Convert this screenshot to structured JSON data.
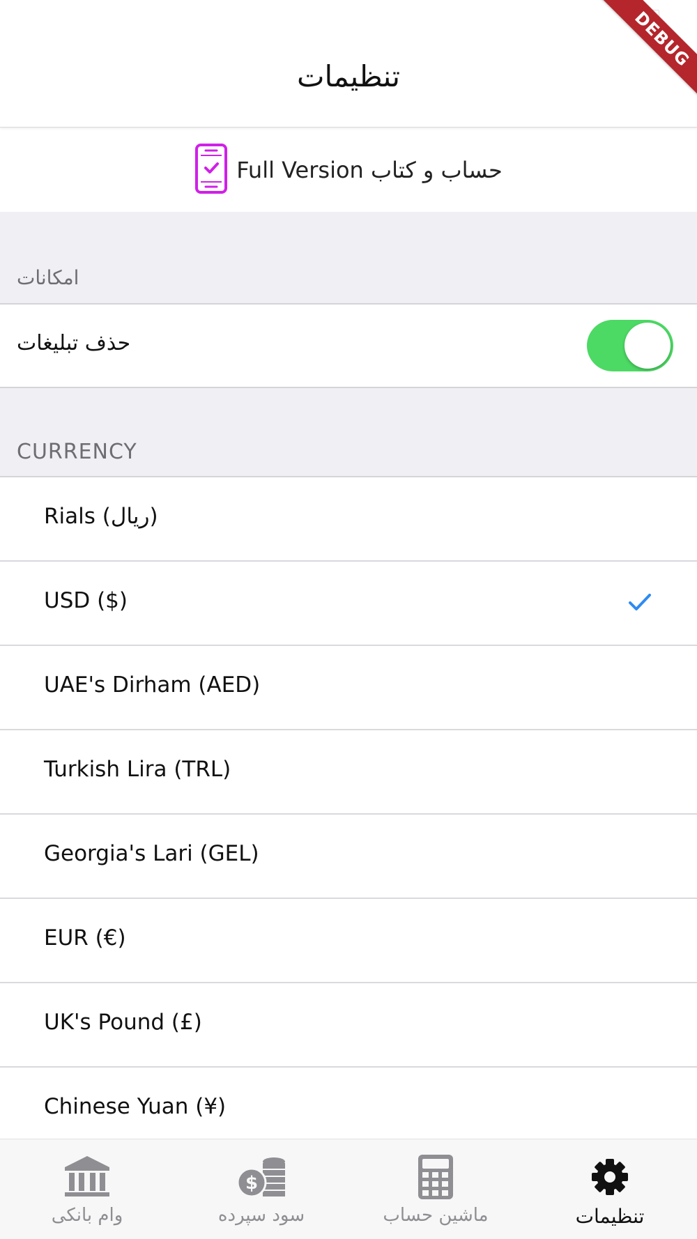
{
  "header": {
    "title": "تنظیمات",
    "debug_banner": "DEBUG"
  },
  "full_version": {
    "label": "حساب و کتاب Full Version",
    "icon": "phone-check-icon",
    "icon_color": "#d020e8"
  },
  "features_section": {
    "title": "امکانات"
  },
  "remove_ads": {
    "label": "حذف تبلیغات",
    "enabled": true,
    "toggle_color": "#4cd964"
  },
  "currency_section": {
    "title": "CURRENCY",
    "selected_index": 1,
    "check_color": "#2f8bf0",
    "items": [
      {
        "label": "Rials (ریال)"
      },
      {
        "label": "USD ($)"
      },
      {
        "label": "UAE's Dirham (AED)"
      },
      {
        "label": "Turkish Lira (TRL)"
      },
      {
        "label": "Georgia's Lari (GEL)"
      },
      {
        "label": "EUR (€)"
      },
      {
        "label": "UK's Pound (£)"
      },
      {
        "label": "Chinese Yuan (¥)"
      }
    ]
  },
  "bottom_nav": {
    "items": [
      {
        "label": "وام بانکی",
        "icon": "bank-icon",
        "active": false
      },
      {
        "label": "سود سپرده",
        "icon": "coins-dollar-icon",
        "active": false
      },
      {
        "label": "ماشین حساب",
        "icon": "calculator-icon",
        "active": false
      },
      {
        "label": "تنظیمات",
        "icon": "gear-icon",
        "active": true
      }
    ]
  }
}
